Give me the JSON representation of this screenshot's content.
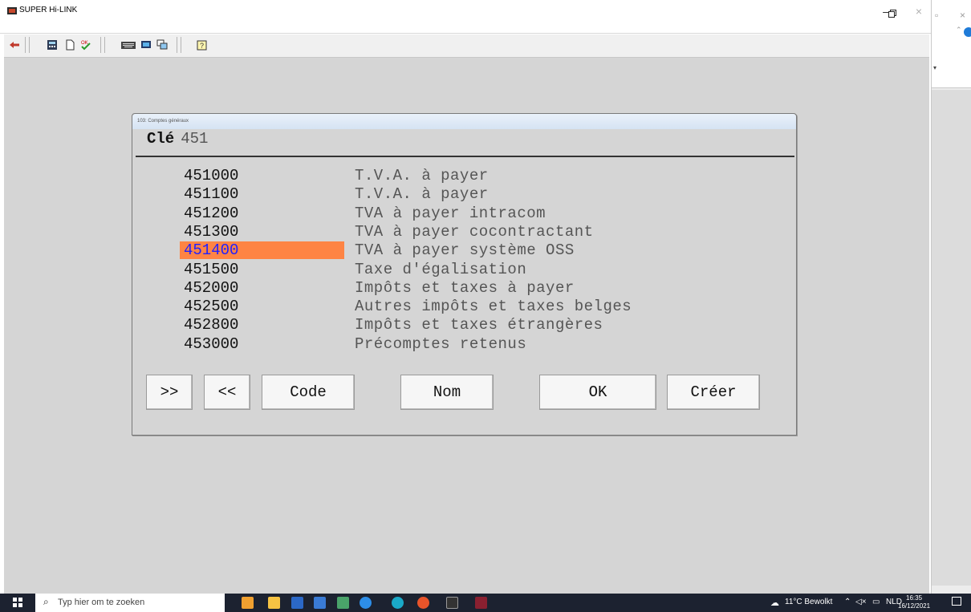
{
  "window": {
    "title": "SUPER Hi-LINK"
  },
  "dialog": {
    "caption": "103: Comptes généraux",
    "key_label": "Clé",
    "key_value": "451",
    "rows": [
      {
        "code": "451000",
        "name": "T.V.A. à payer",
        "selected": false
      },
      {
        "code": "451100",
        "name": "T.V.A. à payer",
        "selected": false
      },
      {
        "code": "451200",
        "name": "TVA à payer intracom",
        "selected": false
      },
      {
        "code": "451300",
        "name": "TVA à payer cocontractant",
        "selected": false
      },
      {
        "code": "451400",
        "name": "TVA à payer système OSS",
        "selected": true
      },
      {
        "code": "451500",
        "name": "Taxe d'égalisation",
        "selected": false
      },
      {
        "code": "452000",
        "name": "Impôts et taxes à payer",
        "selected": false
      },
      {
        "code": "452500",
        "name": "Autres impôts et taxes belges",
        "selected": false
      },
      {
        "code": "452800",
        "name": "Impôts et taxes étrangères",
        "selected": false
      },
      {
        "code": "453000",
        "name": "Précomptes retenus",
        "selected": false
      }
    ],
    "buttons": {
      "next": ">>",
      "prev": "<<",
      "code": "Code",
      "nom": "Nom",
      "ok": "OK",
      "creer": "Créer"
    }
  },
  "taskbar": {
    "search_placeholder": "Typ hier om te zoeken",
    "weather": "11°C Bewolkt",
    "language": "NLD",
    "time": "16:35",
    "date": "16/12/2021"
  },
  "colors": {
    "selection": "#fe8444",
    "selected_text": "#2020ff",
    "workspace": "#d5d5d5"
  }
}
